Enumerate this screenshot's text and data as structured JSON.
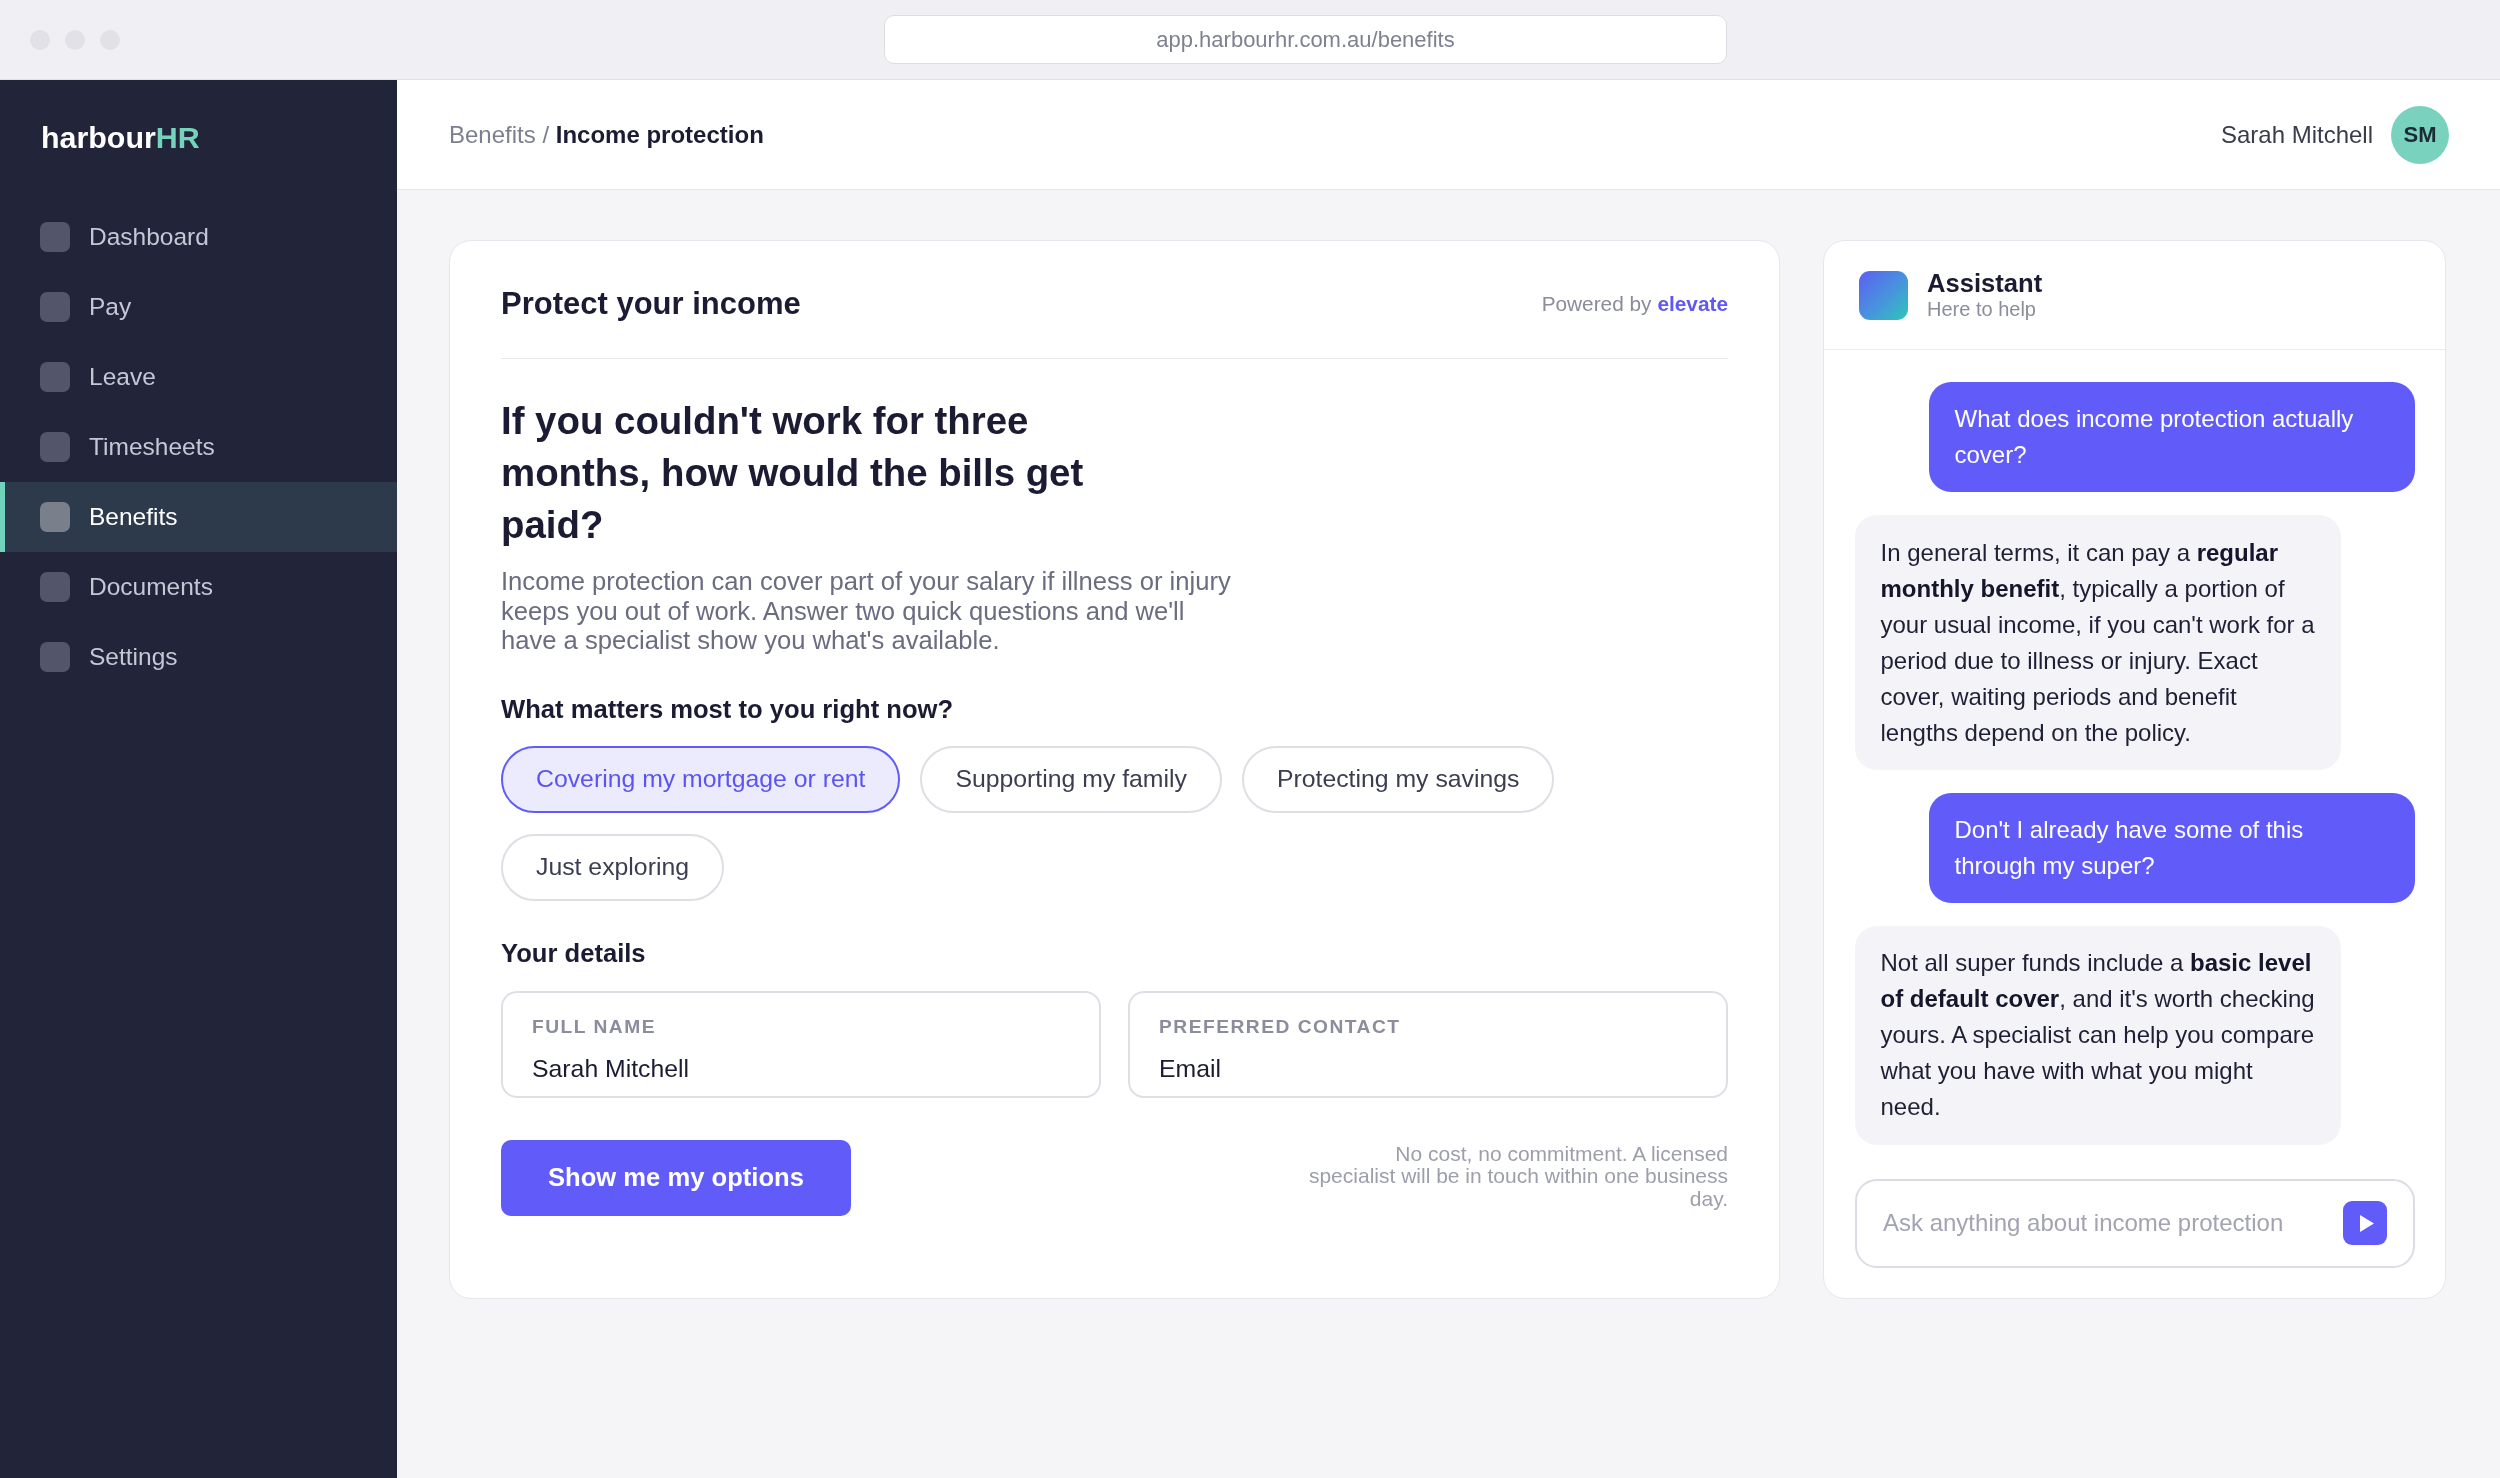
{
  "browser": {
    "url": "app.harbourhr.com.au/benefits"
  },
  "sidebar": {
    "logo": {
      "text": "harbour",
      "accent": "HR"
    },
    "items": [
      {
        "label": "Dashboard",
        "selected": false
      },
      {
        "label": "Pay",
        "selected": false
      },
      {
        "label": "Leave",
        "selected": false
      },
      {
        "label": "Timesheets",
        "selected": false
      },
      {
        "label": "Benefits",
        "selected": true
      },
      {
        "label": "Documents",
        "selected": false
      },
      {
        "label": "Settings",
        "selected": false
      }
    ]
  },
  "header": {
    "breadcrumb": {
      "separator": "/",
      "items": [
        {
          "label": "Benefits",
          "current": false
        },
        {
          "label": "Income protection",
          "current": true
        }
      ]
    },
    "user": {
      "name": "Sarah Mitchell",
      "initials": "SM"
    }
  },
  "income_card": {
    "title": "Protect your income",
    "powered_by": {
      "label": "Powered by",
      "brand": "elevate"
    },
    "headline": "If you couldn't work for three months, how would the bills get paid?",
    "intro": "Income protection can cover part of your salary if illness or injury keeps you out of work. Answer two quick questions and we'll have a specialist show you what's available.",
    "question": "What matters most to you right now?",
    "options": [
      {
        "label": "Covering my mortgage or rent",
        "selected": true
      },
      {
        "label": "Supporting my family",
        "selected": false
      },
      {
        "label": "Protecting my savings",
        "selected": false
      },
      {
        "label": "Just exploring",
        "selected": false
      }
    ],
    "details_title": "Your details",
    "fields": [
      {
        "label": "FULL NAME",
        "value": "Sarah Mitchell"
      },
      {
        "label": "PREFERRED CONTACT",
        "value": "Email"
      }
    ],
    "submit": "Show me my options",
    "note": "No cost, no commitment. A licensed specialist will be in touch within one business day."
  },
  "assistant": {
    "title": "Assistant",
    "subtitle": "Here to help",
    "messages": [
      {
        "kind": "user",
        "text": "What does income protection actually cover?"
      },
      {
        "kind": "assistant",
        "text": "In general terms, it can pay a **regular monthly benefit**, typically a portion of your usual income, if you can't work for a period due to illness or injury. Exact cover, waiting periods and benefit lengths depend on the policy."
      },
      {
        "kind": "user",
        "text": "Don't I already have some of this through my super?"
      },
      {
        "kind": "assistant",
        "text": "Not all super funds include a **basic level of default cover**, and it's worth checking yours. A specialist can help you compare what you have with what you might need."
      }
    ],
    "input": {
      "placeholder": "Ask anything about income protection"
    }
  }
}
